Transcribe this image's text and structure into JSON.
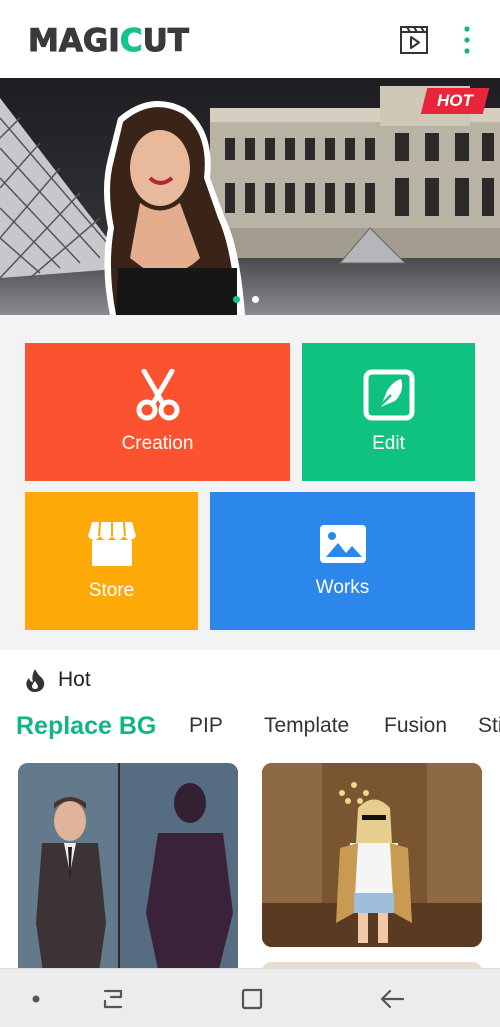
{
  "app": {
    "logo_left": "MAGI",
    "logo_accent": "C",
    "logo_right": "UT"
  },
  "banner": {
    "badge": "HOT",
    "slides": 2,
    "active_slide": 1
  },
  "tiles": [
    {
      "label": "Creation",
      "icon": "scissors-icon",
      "color": "#fb532f"
    },
    {
      "label": "Edit",
      "icon": "feather-edit-icon",
      "color": "#10c27f"
    },
    {
      "label": "Store",
      "icon": "shop-icon",
      "color": "#fdaa08"
    },
    {
      "label": "Works",
      "icon": "image-gallery-icon",
      "color": "#2b87ea"
    }
  ],
  "hot": {
    "title": "Hot",
    "icon": "flame-icon",
    "tabs": [
      "Replace BG",
      "PIP",
      "Template",
      "Fusion",
      "Sti"
    ],
    "active_tab": "Replace BG"
  },
  "colors": {
    "accent": "#10b783"
  }
}
